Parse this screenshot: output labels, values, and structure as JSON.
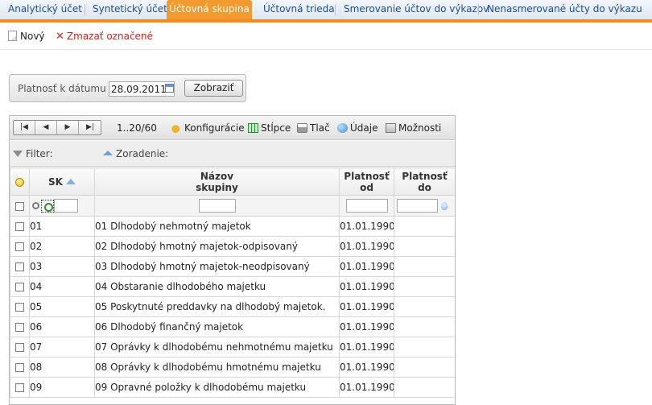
{
  "tabs": [
    {
      "label": "Analytický účet",
      "active": false
    },
    {
      "label": "Syntetický účet",
      "active": false
    },
    {
      "label": "Účtovná skupina",
      "active": true
    },
    {
      "label": "Účtovná trieda",
      "active": false
    },
    {
      "label": "Smerovanie účtov do výkazov",
      "active": false
    },
    {
      "label": "Nenasmerované účty do výkazu",
      "active": false
    }
  ],
  "actions": {
    "new_label": "Nový",
    "delete_label": "Zmazať označené"
  },
  "date_filter": {
    "label": "Platnosť k dátumu",
    "value": "28.09.2011",
    "button_label": "Zobraziť"
  },
  "grid_toolbar": {
    "page_info": "1..20/60",
    "configuration": "Konfigurácie",
    "columns": "Stĺpce",
    "print": "Tlač",
    "data": "Údaje",
    "options": "Možnosti"
  },
  "filter_bar": {
    "filter_label": "Filter:",
    "sort_label": "Zoradenie:"
  },
  "columns": {
    "code": "SK",
    "name_line1": "Názov",
    "name_line2": "skupiny",
    "valid_from_line1": "Platnosť",
    "valid_from_line2": "od",
    "valid_to_line1": "Platnosť",
    "valid_to_line2": "do"
  },
  "rows": [
    {
      "code": "01",
      "name": "01 Dlhodobý nehmotný majetok",
      "valid_from": "01.01.1990",
      "valid_to": ""
    },
    {
      "code": "02",
      "name": "02 Dlhodobý hmotný majetok-odpisovaný",
      "valid_from": "01.01.1990",
      "valid_to": ""
    },
    {
      "code": "03",
      "name": "03 Dlhodobý hmotný majetok-neodpisovaný",
      "valid_from": "01.01.1990",
      "valid_to": ""
    },
    {
      "code": "04",
      "name": "04 Obstaranie dlhodobého majetku",
      "valid_from": "01.01.1990",
      "valid_to": ""
    },
    {
      "code": "05",
      "name": "05 Poskytnuté preddavky na dlhodobý majetok.",
      "valid_from": "01.01.1990",
      "valid_to": ""
    },
    {
      "code": "06",
      "name": "06 Dlhodobý finančný majetok",
      "valid_from": "01.01.1990",
      "valid_to": ""
    },
    {
      "code": "07",
      "name": "07 Oprávky k dlhodobému nehmotnému majetku",
      "valid_from": "01.01.1990",
      "valid_to": ""
    },
    {
      "code": "08",
      "name": "08 Oprávky k dlhodobému hmotnému majetku",
      "valid_from": "01.01.1990",
      "valid_to": ""
    },
    {
      "code": "09",
      "name": "09 Opravné položky k dlhodobému majetku",
      "valid_from": "01.01.1990",
      "valid_to": ""
    }
  ]
}
